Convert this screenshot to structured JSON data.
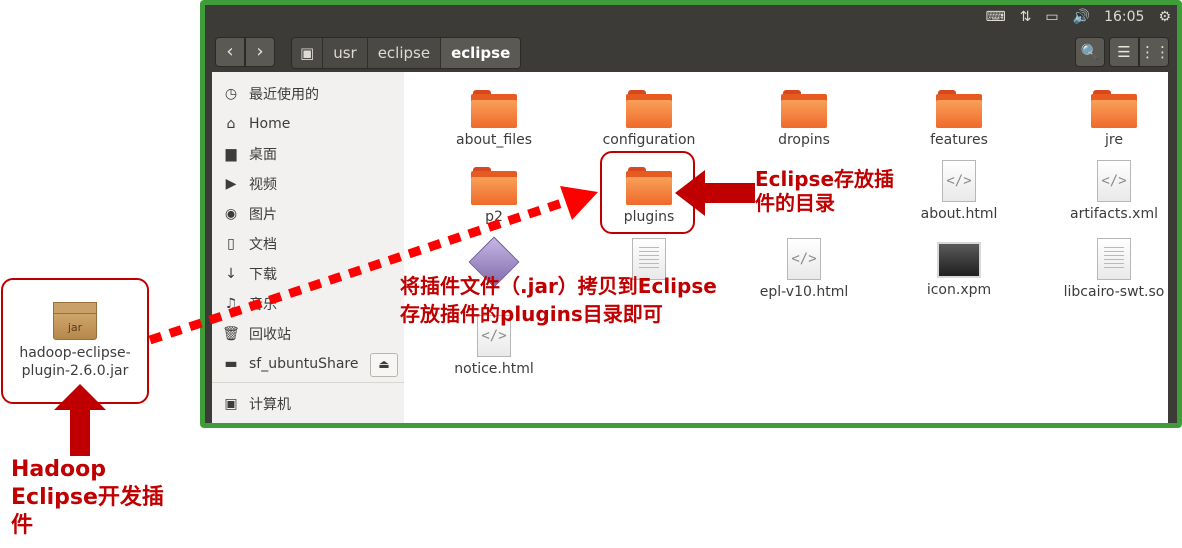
{
  "topbar": {
    "time": "16:05"
  },
  "breadcrumbs": [
    "usr",
    "eclipse",
    "eclipse"
  ],
  "sidebar": {
    "items": [
      {
        "icon": "clock-icon",
        "label": "最近使用的"
      },
      {
        "icon": "home-icon",
        "label": "Home"
      },
      {
        "icon": "folder-icon",
        "label": "桌面"
      },
      {
        "icon": "video-icon",
        "label": "视频"
      },
      {
        "icon": "camera-icon",
        "label": "图片"
      },
      {
        "icon": "document-icon",
        "label": "文档"
      },
      {
        "icon": "download-icon",
        "label": "下载"
      },
      {
        "icon": "music-icon",
        "label": "音乐"
      },
      {
        "icon": "trash-icon",
        "label": "回收站"
      },
      {
        "icon": "drive-icon",
        "label": "sf_ubuntuShare"
      },
      {
        "icon": "computer-icon",
        "label": "计算机"
      }
    ]
  },
  "files": [
    {
      "name": "about_files",
      "type": "folder"
    },
    {
      "name": "configuration",
      "type": "folder"
    },
    {
      "name": "dropins",
      "type": "folder"
    },
    {
      "name": "features",
      "type": "folder"
    },
    {
      "name": "jre",
      "type": "folder"
    },
    {
      "name": "p2",
      "type": "folder"
    },
    {
      "name": "plugins",
      "type": "folder"
    },
    {
      "name": "about.html",
      "type": "html"
    },
    {
      "name": "artifacts.xml",
      "type": "html"
    },
    {
      "name": "epl-v10.html",
      "type": "html"
    },
    {
      "name": "icon.xpm",
      "type": "image"
    },
    {
      "name": "libcairo-swt.so",
      "type": "text"
    },
    {
      "name": "notice.html",
      "type": "html"
    }
  ],
  "jar_file": {
    "icon_text": "jar",
    "line1": "hadoop-eclipse-",
    "line2": "plugin-2.6.0.jar"
  },
  "annotations": {
    "plugin_dir_line1": "Eclipse存放插",
    "plugin_dir_line2": "件的目录",
    "copy_line1": "将插件文件（.jar）拷贝到Eclipse",
    "copy_line2": "存放插件的plugins目录即可",
    "hadoop_line1": "Hadoop",
    "hadoop_line2": "Eclipse开发插",
    "hadoop_line3": "件"
  },
  "colors": {
    "annotation_red": "#c00000",
    "frame_green": "#3f9d39",
    "folder_orange": "#ef6a2a"
  }
}
